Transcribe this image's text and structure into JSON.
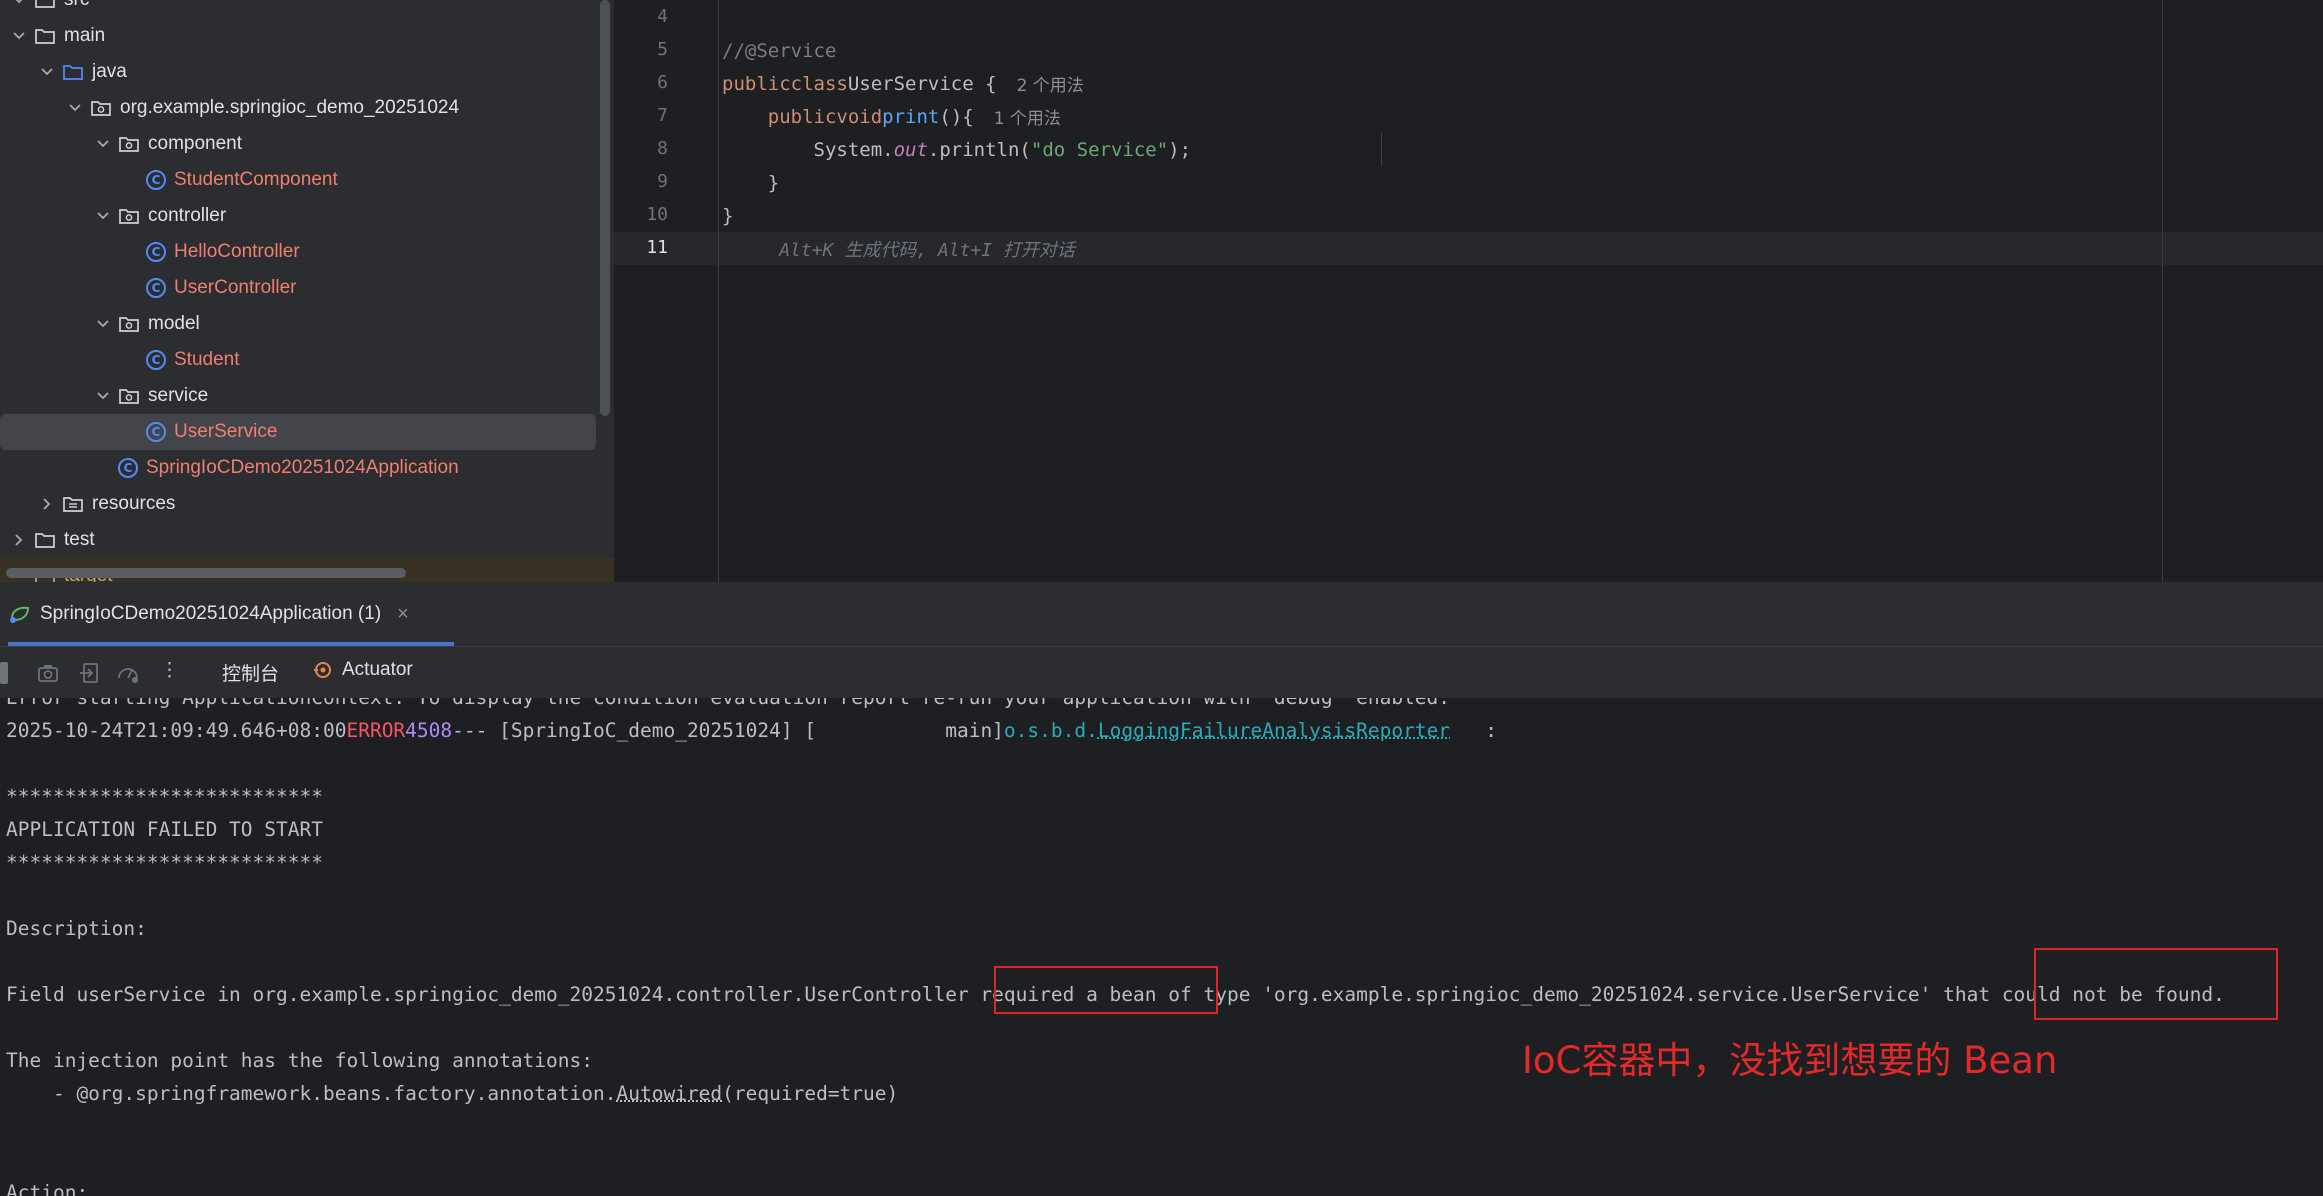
{
  "project_tree": {
    "items": [
      {
        "label": "src",
        "depth": 0,
        "kind": "folder",
        "expanded": true
      },
      {
        "label": "main",
        "depth": 0,
        "kind": "folder",
        "expanded": true
      },
      {
        "label": "java",
        "depth": 1,
        "kind": "source-folder",
        "expanded": true
      },
      {
        "label": "org.example.springioc_demo_20251024",
        "depth": 2,
        "kind": "package",
        "expanded": true
      },
      {
        "label": "component",
        "depth": 3,
        "kind": "package",
        "expanded": true
      },
      {
        "label": "StudentComponent",
        "depth": 4,
        "kind": "class"
      },
      {
        "label": "controller",
        "depth": 3,
        "kind": "package",
        "expanded": true
      },
      {
        "label": "HelloController",
        "depth": 4,
        "kind": "class"
      },
      {
        "label": "UserController",
        "depth": 4,
        "kind": "class"
      },
      {
        "label": "model",
        "depth": 3,
        "kind": "package",
        "expanded": true
      },
      {
        "label": "Student",
        "depth": 4,
        "kind": "class"
      },
      {
        "label": "service",
        "depth": 3,
        "kind": "package",
        "expanded": true
      },
      {
        "label": "UserService",
        "depth": 4,
        "kind": "class",
        "selected": true
      },
      {
        "label": "SpringIoCDemo20251024Application",
        "depth": 3,
        "kind": "app-class"
      },
      {
        "label": "resources",
        "depth": 1,
        "kind": "folder",
        "expanded": false
      },
      {
        "label": "test",
        "depth": 0,
        "kind": "folder",
        "expanded": false
      },
      {
        "label": "target",
        "depth": 0,
        "kind": "excluded-folder"
      }
    ]
  },
  "editor": {
    "line_numbers": [
      "4",
      "5",
      "6",
      "7",
      "8",
      "9",
      "10",
      "11"
    ],
    "code": {
      "l5_comment": "//@Service",
      "l6_kw1": "public",
      "l6_kw2": "class",
      "l6_name": "UserService {",
      "l6_hint": "2 个用法",
      "l7_kw1": "public",
      "l7_kw2": "void",
      "l7_fn": "print",
      "l7_rest": "(){",
      "l7_hint": "1 个用法",
      "l8_a": "System.",
      "l8_out": "out",
      "l8_b": ".println(",
      "l8_str": "\"do Service\"",
      "l8_c": ");",
      "l9": "}",
      "l10": "}",
      "l11_ghost": "Alt+K 生成代码, Alt+I 打开对话"
    }
  },
  "run_panel": {
    "tab_label": "SpringIoCDemo20251024Application (1)",
    "close_glyph": "×",
    "toolbar": {
      "console_label": "控制台",
      "actuator_label": "Actuator",
      "more_glyph": "⋮"
    }
  },
  "console": {
    "line_top": "Error starting ApplicationContext. To display the condition evaluation report re-run your application with 'debug' enabled.",
    "log_timestamp": "2025-10-24T21:09:49.646+08:00",
    "log_level": "ERROR",
    "log_pid": "4508",
    "log_mid": "--- [SpringIoC_demo_20251024] [           main]",
    "log_logger_prefix": "o.s.b.d.",
    "log_logger_name": "LoggingFailureAnalysisReporter",
    "log_tail": "   :",
    "stars": "***************************",
    "failed": "APPLICATION FAILED TO START",
    "description": "Description:",
    "field_a": "Field userService in org.example.springioc_demo_20251024.controller.UserController ",
    "field_b": "required a bean of",
    "field_c": " type 'org.example.springioc_demo_20251024.service.UserService' that ",
    "field_d": "could not be found.",
    "injection": "The injection point has the following annotations:",
    "annot_a": "    - @org.springframework.beans.factory.annotation.",
    "annot_link": "Autowired",
    "annot_b": "(required=true)",
    "action": "Action:"
  },
  "annotation_text": "IoC容器中，没找到想要的 Bean",
  "colors": {
    "highlight_box": "#e0242a",
    "annotation": "#e32a2a",
    "error": "#f75464"
  }
}
